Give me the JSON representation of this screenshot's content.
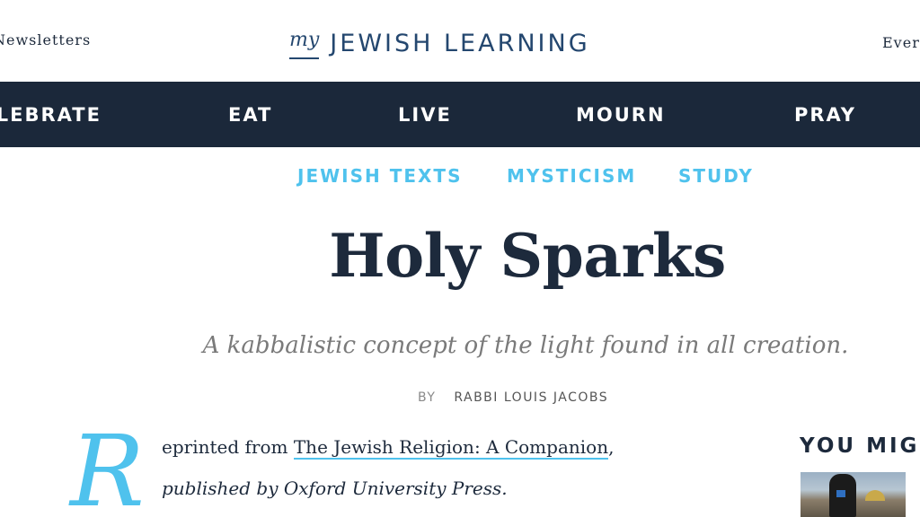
{
  "header": {
    "newsletters_label": "Newsletters",
    "logo_my": "my",
    "logo_main": "JEWISH LEARNING",
    "right_label": "Ever"
  },
  "nav": {
    "items": [
      "CELEBRATE",
      "EAT",
      "LIVE",
      "MOURN",
      "PRAY"
    ]
  },
  "subnav": {
    "items": [
      "JEWISH TEXTS",
      "MYSTICISM",
      "STUDY"
    ]
  },
  "article": {
    "title": "Holy Sparks",
    "subtitle": "A kabbalistic concept of the light found in all creation.",
    "by_label": "BY",
    "author": "RABBI LOUIS JACOBS",
    "dropcap": "R",
    "line1_before": "eprinted from ",
    "book_title": "The Jewish Religion: A Companion",
    "line1_after": ",",
    "line2": "published by Oxford University Press."
  },
  "sidebar": {
    "heading": "YOU MIGHT"
  },
  "colors": {
    "navy": "#1b283a",
    "accent_blue": "#4fc2ed",
    "logo_blue": "#24476f"
  }
}
